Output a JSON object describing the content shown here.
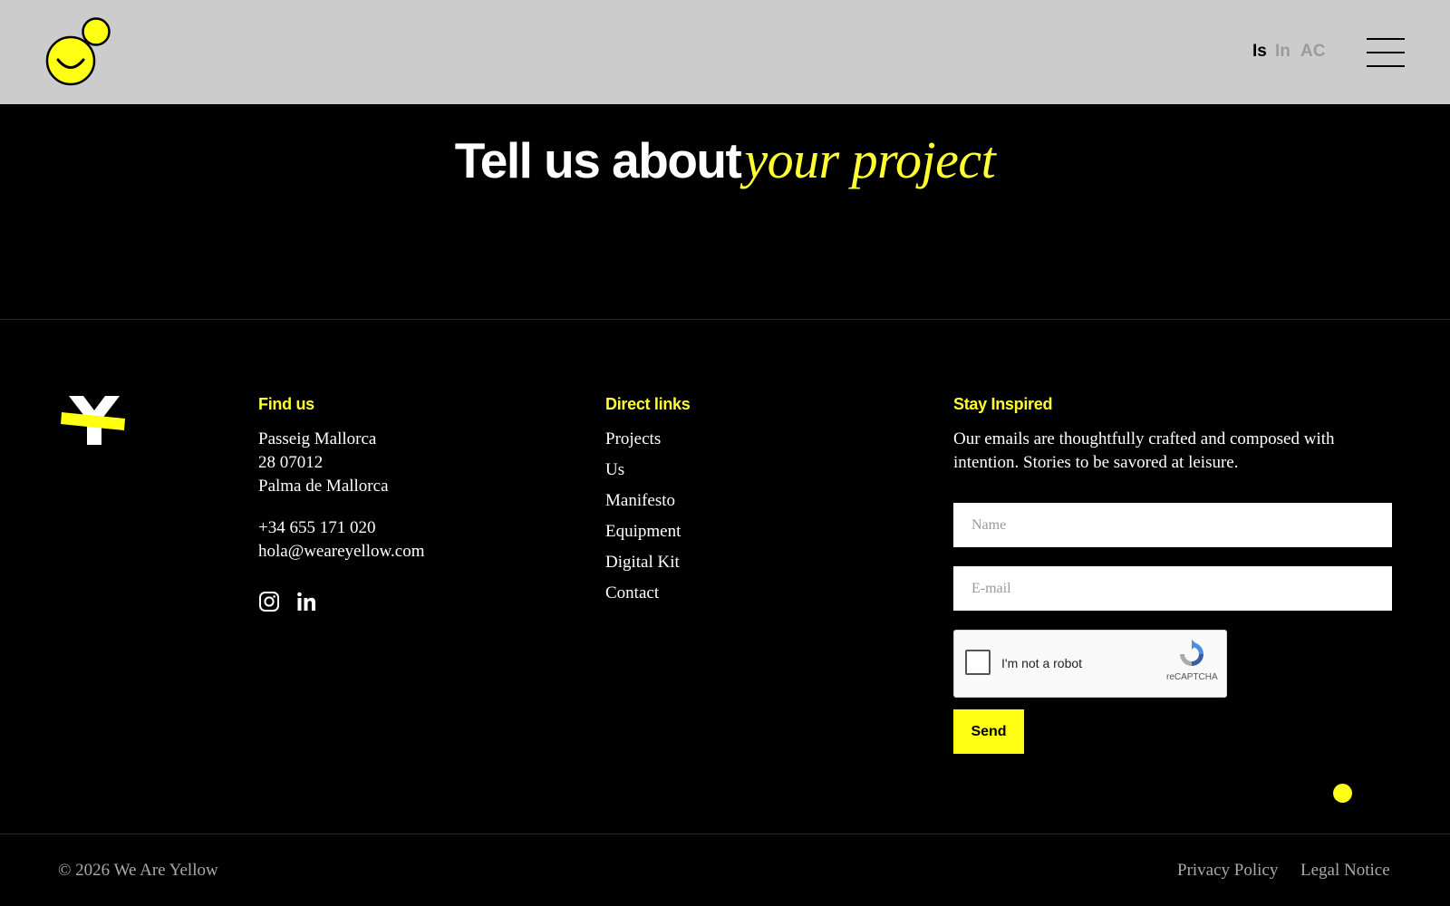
{
  "header": {
    "languages": [
      "Is",
      "In",
      "AC"
    ]
  },
  "hero": {
    "title_plain": "Tell us about",
    "title_italic": "your project"
  },
  "footer": {
    "find_us": {
      "title": "Find us",
      "address_line1": "Passeig Mallorca",
      "address_line2": "28 07012",
      "address_line3": "Palma de Mallorca",
      "phone": "+34 655 171 020",
      "email": "hola@weareyellow.com",
      "social": [
        "instagram-icon",
        "linkedin-icon"
      ]
    },
    "direct_links": {
      "title": "Direct links",
      "items": [
        "Projects",
        "Us",
        "Manifesto",
        "Equipment",
        "Digital Kit",
        "Contact"
      ]
    },
    "stay_inspired": {
      "title": "Stay Inspired",
      "line1": "Our emails are thoughtfully crafted and composed with",
      "line2": "intention. Stories to be savored at leisure.",
      "name_placeholder": "Name",
      "email_placeholder": "E-mail",
      "captcha_label": "I'm not a robot",
      "captcha_brand": "reCAPTCHA",
      "send_label": "Send"
    },
    "copyright": "© 2026 We Are Yellow",
    "legal_links": [
      "Privacy Policy",
      "Legal Notice"
    ]
  },
  "colors": {
    "accent_yellow": "#ffff14",
    "header_bg": "#cccccc",
    "background": "#000000"
  }
}
